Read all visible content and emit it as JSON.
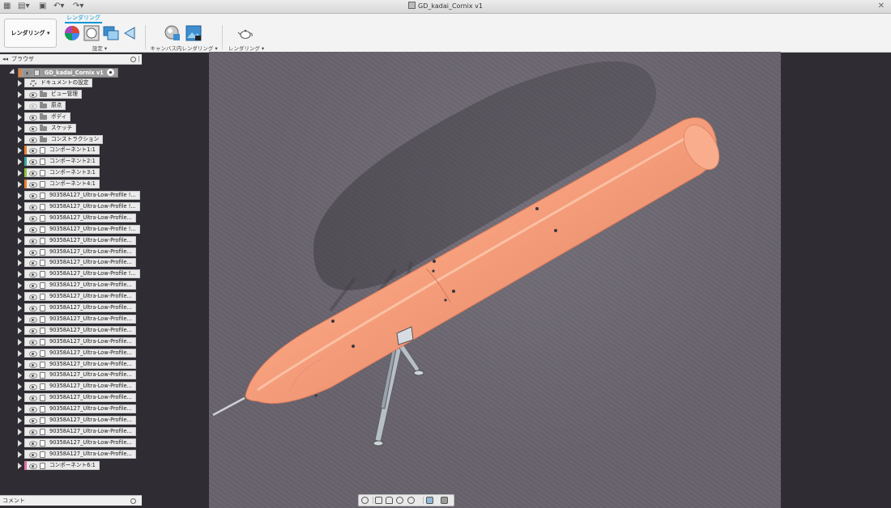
{
  "title": "GD_kadai_Cornix v1",
  "toolbar": {
    "workspace": "レンダリング ▾",
    "tab": "レンダリング",
    "groups": [
      {
        "label": "設定 ▾"
      },
      {
        "label": "キャンバス内レンダリング ▾"
      },
      {
        "label": "レンダリング ▾"
      }
    ]
  },
  "browser": {
    "header": "ブラウザ",
    "root": "GD_kadai_Cornix v1",
    "items": [
      {
        "label": "ドキュメントの設定",
        "icon": "gear-icon"
      },
      {
        "label": "ビュー管理",
        "icon": "folder-icon"
      },
      {
        "label": "原点",
        "icon": "folder-icon",
        "hidden": true
      },
      {
        "label": "ボディ",
        "icon": "folder-icon"
      },
      {
        "label": "スケッチ",
        "icon": "folder-icon"
      },
      {
        "label": "コンストラクション",
        "icon": "folder-icon"
      },
      {
        "label": "コンポーネント1:1",
        "icon": "component-icon",
        "color": "#e8812e"
      },
      {
        "label": "コンポーネント2:1",
        "icon": "component-icon",
        "color": "#3aa6a0"
      },
      {
        "label": "コンポーネント3:1",
        "icon": "component-icon",
        "color": "#8fc23f"
      },
      {
        "label": "コンポーネント4:1",
        "icon": "component-icon",
        "color": "#e8812e"
      },
      {
        "label": "90358A127_Ultra-Low-Profile !...",
        "icon": "component-icon"
      },
      {
        "label": "90358A127_Ultra-Low-Profile !...",
        "icon": "component-icon"
      },
      {
        "label": "90358A127_Ultra-Low-Profile...",
        "icon": "component-icon"
      },
      {
        "label": "90358A127_Ultra-Low-Profile !...",
        "icon": "component-icon"
      },
      {
        "label": "90358A127_Ultra-Low-Profile...",
        "icon": "component-icon"
      },
      {
        "label": "90358A127_Ultra-Low-Profile...",
        "icon": "component-icon"
      },
      {
        "label": "90358A127_Ultra-Low-Profile...",
        "icon": "component-icon"
      },
      {
        "label": "90358A127_Ultra-Low-Profile !...",
        "icon": "component-icon"
      },
      {
        "label": "90358A127_Ultra-Low-Profile...",
        "icon": "component-icon"
      },
      {
        "label": "90358A127_Ultra-Low-Profile...",
        "icon": "component-icon"
      },
      {
        "label": "90358A127_Ultra-Low-Profile...",
        "icon": "component-icon"
      },
      {
        "label": "90358A127_Ultra-Low-Profile...",
        "icon": "component-icon"
      },
      {
        "label": "90358A127_Ultra-Low-Profile...",
        "icon": "component-icon"
      },
      {
        "label": "90358A127_Ultra-Low-Profile...",
        "icon": "component-icon"
      },
      {
        "label": "90358A127_Ultra-Low-Profile...",
        "icon": "component-icon"
      },
      {
        "label": "90358A127_Ultra-Low-Profile...",
        "icon": "component-icon"
      },
      {
        "label": "90358A127_Ultra-Low-Profile...",
        "icon": "component-icon"
      },
      {
        "label": "90358A127_Ultra-Low-Profile...",
        "icon": "component-icon"
      },
      {
        "label": "90358A127_Ultra-Low-Profile...",
        "icon": "component-icon"
      },
      {
        "label": "90358A127_Ultra-Low-Profile...",
        "icon": "component-icon"
      },
      {
        "label": "90358A127_Ultra-Low-Profile...",
        "icon": "component-icon"
      },
      {
        "label": "90358A127_Ultra-Low-Profile...",
        "icon": "component-icon"
      },
      {
        "label": "90358A127_Ultra-Low-Profile...",
        "icon": "component-icon"
      },
      {
        "label": "90358A127_Ultra-Low-Profile...",
        "icon": "component-icon"
      },
      {
        "label": "コンポーネント6:1",
        "icon": "component-icon",
        "color": "#e06fa0"
      }
    ]
  },
  "comments": {
    "header": "コメント"
  },
  "colors": {
    "accent": "#0696d7",
    "model": "#f79f7c",
    "canvas": "#67626c",
    "sidebar_bg": "#2f2d33"
  }
}
